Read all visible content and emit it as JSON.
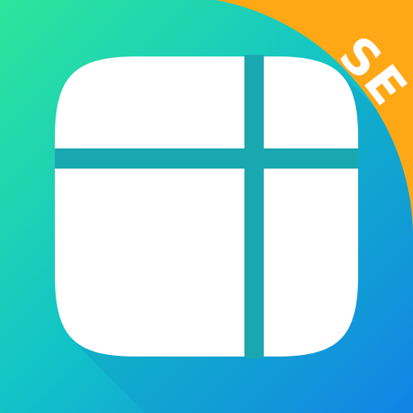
{
  "icon": {
    "badge_label": "SE",
    "glyph": "grid-layout-icon"
  },
  "colors": {
    "gradient_top_left": "#2ee59a",
    "gradient_middle": "#12c3c8",
    "gradient_bottom_right": "#1282e6",
    "tile_fill": "#ffffff",
    "grid_lines": "#1aa8b0",
    "badge_ribbon": "#ffa816",
    "badge_text": "#ffffff",
    "shadow": "#0a6fc0"
  }
}
